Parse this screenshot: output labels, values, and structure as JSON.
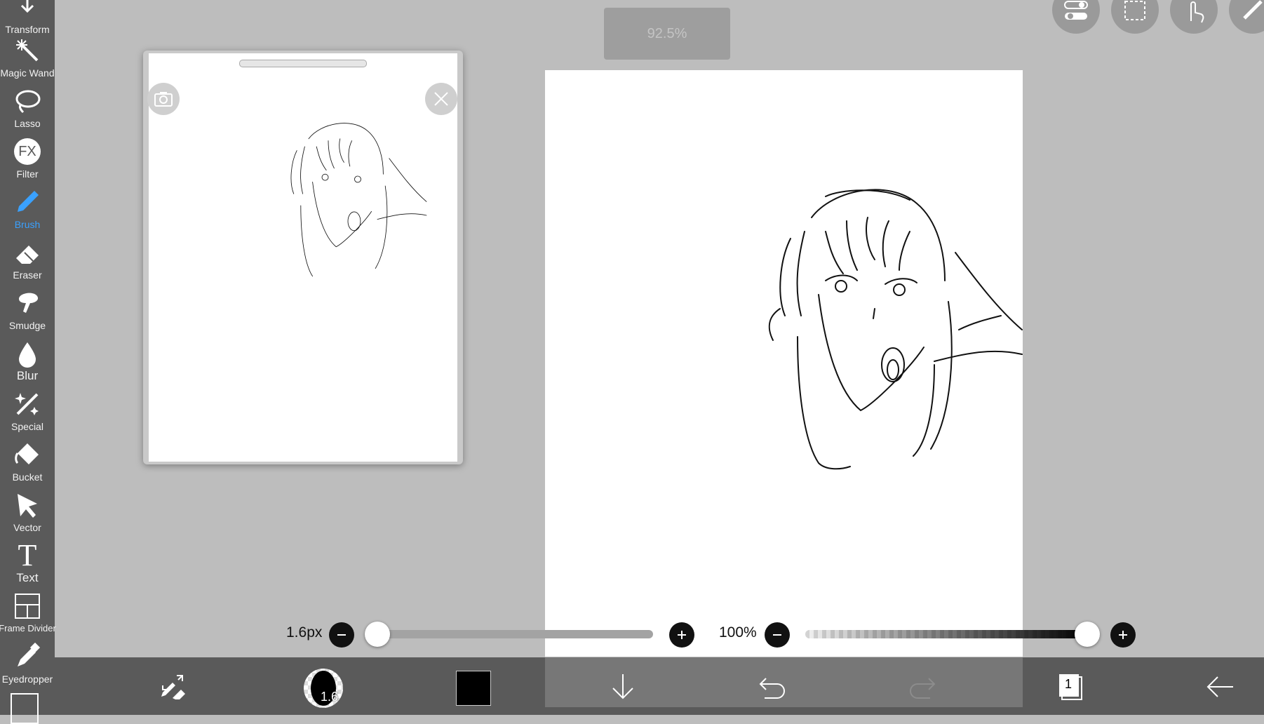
{
  "toolbar": {
    "items": [
      {
        "label": "Transform",
        "icon": "transform-icon"
      },
      {
        "label": "Magic Wand",
        "icon": "magic-wand-icon"
      },
      {
        "label": "Lasso",
        "icon": "lasso-icon"
      },
      {
        "label": "Filter",
        "icon": "fx-icon",
        "glyph": "FX"
      },
      {
        "label": "Brush",
        "icon": "brush-icon",
        "active": true
      },
      {
        "label": "Eraser",
        "icon": "eraser-icon"
      },
      {
        "label": "Smudge",
        "icon": "smudge-icon"
      },
      {
        "label": "Blur",
        "icon": "blur-drop-icon"
      },
      {
        "label": "Special",
        "icon": "special-sparkle-icon"
      },
      {
        "label": "Bucket",
        "icon": "bucket-icon"
      },
      {
        "label": "Vector",
        "icon": "vector-arrow-icon"
      },
      {
        "label": "Text",
        "icon": "text-icon",
        "glyph": "T"
      },
      {
        "label": "Frame Divider",
        "icon": "frame-divider-icon"
      },
      {
        "label": "Eyedropper",
        "icon": "eyedropper-icon"
      }
    ],
    "active_color": "#3aa1ff"
  },
  "zoom": {
    "value": "92.5%"
  },
  "reference_window": {
    "camera_icon": "camera-icon",
    "close_icon": "close-icon"
  },
  "top_buttons": [
    "toggle-settings-icon",
    "selection-icon",
    "touch-icon",
    "ruler-pen-icon"
  ],
  "brush_size": {
    "label": "1.6px",
    "fraction": 0.02
  },
  "opacity": {
    "label": "100%",
    "fraction": 1.0
  },
  "bottom_bar": {
    "brush_preview_value": "1.6",
    "current_color": "#000000",
    "layer_count": "1"
  }
}
